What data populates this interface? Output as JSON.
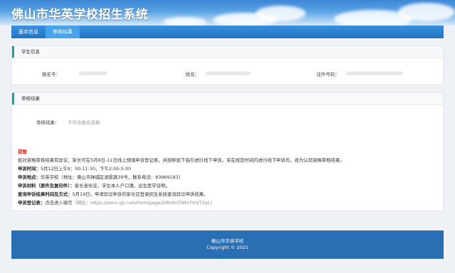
{
  "header": {
    "title": "佛山市华英学校招生系统"
  },
  "nav": {
    "items": [
      {
        "label": "基本信息"
      },
      {
        "label": "审核结果"
      }
    ]
  },
  "student_info": {
    "section_title": "学生信息",
    "reg_no_label": "报名号：",
    "name_label": "姓名：",
    "id_no_label": "证件号码："
  },
  "review": {
    "section_title": "审核结果",
    "result_label": "审核结果：",
    "result_value": "不符合报名资格"
  },
  "notice": {
    "title": "提醒",
    "intro": "如对资格审核结果有异议，家长可在5月8日-11日线上预填申诉登记表，并按照如下指引进行线下申诉。未在规定时间内进行线下申诉的，视为认同资格审核结果。",
    "time_label": "申诉时间：",
    "time_value": "5月12日上午9：00-11:30，下午2:00-5:00",
    "place_label": "申诉地点：",
    "place_value": "华英学校（地址：佛山市禅城区湖景路39号，联系电话：83969183）",
    "materials_label": "申诉材料（原件及复印件）：",
    "materials_value": "家长身份证，学生本人户口簿，出生医学证明。",
    "query_label": "查询申诉结果时间及方式：",
    "query_value": "5月19日，申请异议申诉的家长应登录招生系统查询异议申诉结果。",
    "form_label": "申诉登记表：",
    "form_value": "点击进入填写",
    "form_url": "（网址：https://docs.qq.com/form/page/DRVdYZWtxTkIVT2pL）"
  },
  "footer": {
    "school": "佛山市华英学校",
    "copyright": "Copyright © 2021"
  }
}
